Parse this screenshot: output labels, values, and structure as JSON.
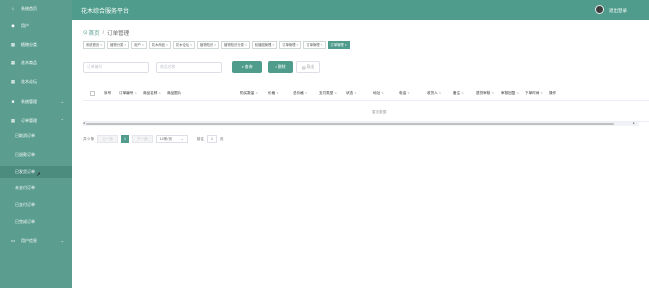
{
  "header": {
    "title": "花木综合服务平台",
    "logout_label": "退出登录"
  },
  "sidebar": {
    "items": [
      {
        "icon": "home-icon",
        "glyph": "⌂",
        "label": "系统首页"
      },
      {
        "icon": "user-icon",
        "glyph": "◆",
        "label": "用户"
      },
      {
        "icon": "grid-icon",
        "glyph": "▦",
        "label": "植物分类"
      },
      {
        "icon": "grid-icon",
        "glyph": "▦",
        "label": "花木商品"
      },
      {
        "icon": "grid-icon",
        "glyph": "▦",
        "label": "花木论坛"
      },
      {
        "icon": "grid-icon",
        "glyph": "■",
        "label": "系统管理",
        "chevron": "⌄"
      },
      {
        "icon": "grid-icon",
        "glyph": "▦",
        "label": "订单管理",
        "chevron": "⌃"
      }
    ],
    "order_sub_items": [
      {
        "label": "已取消订单"
      },
      {
        "label": "已退款订单"
      },
      {
        "label": "已发货订单"
      },
      {
        "label": "未支付订单"
      },
      {
        "label": "已支付订单"
      },
      {
        "label": "已完成订单"
      }
    ],
    "user_info": {
      "icon": "id-card-icon",
      "glyph": "▭",
      "label": "用户信息",
      "chevron": "⌄"
    }
  },
  "breadcrumb": {
    "home": "首页",
    "separator": "/",
    "current": "订单管理"
  },
  "tags": [
    {
      "label": "系统首页",
      "active": false
    },
    {
      "label": "植物分类",
      "active": false
    },
    {
      "label": "用户",
      "active": false
    },
    {
      "label": "花木商品",
      "active": false
    },
    {
      "label": "花木论坛",
      "active": false
    },
    {
      "label": "植物知识",
      "active": false
    },
    {
      "label": "植物知识分类",
      "active": false
    },
    {
      "label": "轮播图管理",
      "active": false
    },
    {
      "label": "订单管理",
      "active": false
    },
    {
      "label": "订单管理",
      "active": false
    },
    {
      "label": "订单管理",
      "active": true
    }
  ],
  "search": {
    "order_no_placeholder": "订单编号",
    "name_placeholder": "商品名称",
    "search_label": "查询",
    "delete_label": "删除",
    "export_label": "导出"
  },
  "table": {
    "columns": [
      "序号",
      "订单编号",
      "商品名称",
      "商品图片",
      "购买数量",
      "价格",
      "总价格",
      "支付类型",
      "状态",
      "地址",
      "电话",
      "收货人",
      "备注",
      "退货审核",
      "审核回复",
      "下单时间",
      "操作"
    ],
    "empty_text": "暂无数据"
  },
  "pagination": {
    "total_text": "共 0 条",
    "prev_label": "上一页",
    "current_page": "1",
    "next_label": "下一页",
    "page_size_label": "10条/页",
    "goto_label": "前往",
    "goto_value": "1",
    "page_suffix": "页"
  },
  "colors": {
    "primary": "#4f9c8c",
    "sidebar": "#5b9e8f"
  }
}
